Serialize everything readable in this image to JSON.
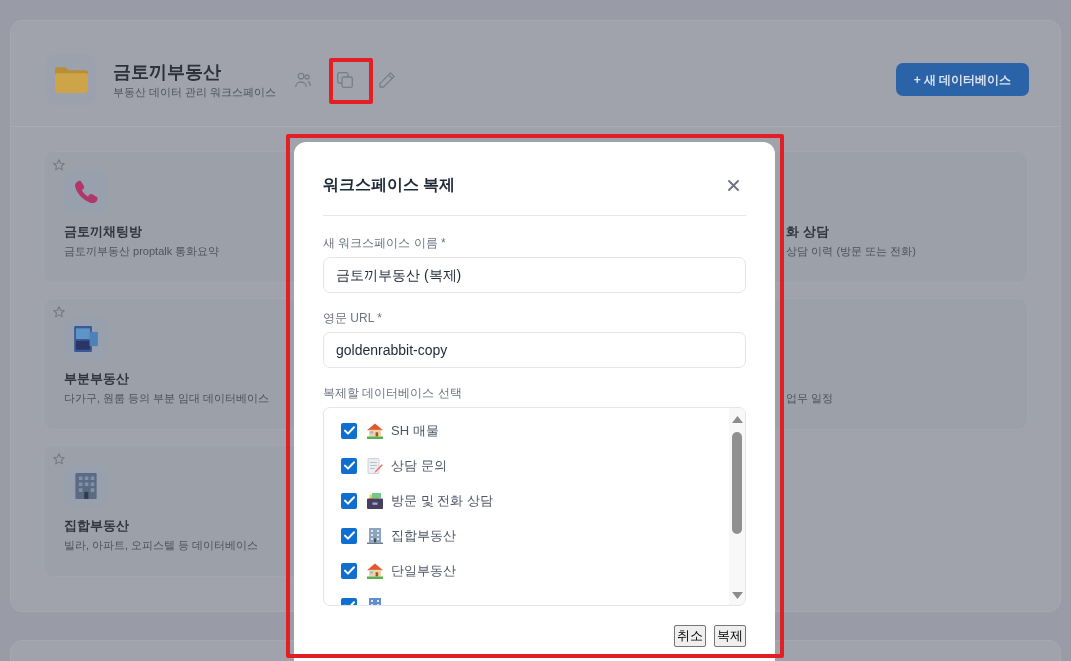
{
  "workspace": {
    "name": "금토끼부동산",
    "description": "부동산 데이터 관리 워크스페이스",
    "new_database_button": "+ 새 데이터베이스"
  },
  "database_grid": {
    "left_cards": [
      {
        "title": "금토끼채팅방",
        "description": "금토끼부동산 proptalk 통화요약",
        "starred": false
      },
      {
        "title": "부분부동산",
        "description": "다가구, 원룸 등의 부분 임대 데이터베이스",
        "starred": false
      },
      {
        "title": "집합부동산",
        "description": "빌라, 아파트, 오피스텔 등 데이터베이스",
        "starred": false
      }
    ],
    "right_cards": [
      {
        "title": "화 상담",
        "description": "상담 이력 (방문 또는 전화)"
      },
      {
        "description": "업무 일정"
      }
    ]
  },
  "duplicate_dialog": {
    "title": "워크스페이스 복제",
    "fields": [
      {
        "label": "새 워크스페이스 이름 *",
        "value": "금토끼부동산 (복제)"
      },
      {
        "label": "영문 URL *",
        "value": "goldenrabbit-copy"
      }
    ],
    "database_list": {
      "label": "복제할 데이터베이스 선택",
      "items": [
        {
          "label": "SH 매물",
          "checked": true
        },
        {
          "label": "상담 문의",
          "checked": true
        },
        {
          "label": "방문 및 전화 상담",
          "checked": true
        },
        {
          "label": "집합부동산",
          "checked": true
        },
        {
          "label": "단일부동산",
          "checked": true
        },
        {
          "checked": true
        }
      ]
    },
    "buttons": [
      "취소",
      "복제"
    ]
  }
}
